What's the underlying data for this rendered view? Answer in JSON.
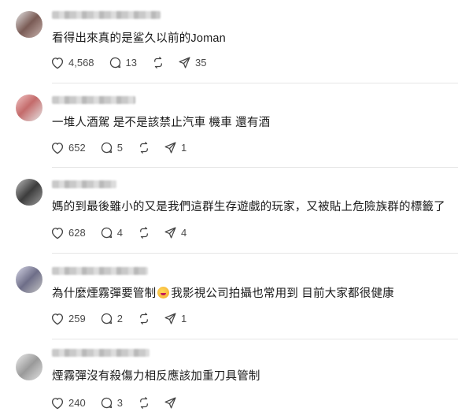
{
  "posts": [
    {
      "text": "看得出來真的是鲨久以前的Joman",
      "likes": "4,568",
      "comments": "13",
      "reposts": "",
      "shares": "35"
    },
    {
      "text": "一堆人酒駕 是不是該禁止汽車 機車 還有酒",
      "likes": "652",
      "comments": "5",
      "reposts": "",
      "shares": "1"
    },
    {
      "text": "媽的到最後雖小的又是我們這群生存遊戲的玩家，又被貼上危險族群的標籤了",
      "likes": "628",
      "comments": "4",
      "reposts": "",
      "shares": "4"
    },
    {
      "text_before_emoji": "為什麼煙霧彈要管制",
      "text_after_emoji": "我影視公司拍攝也常用到 目前大家都很健康",
      "emoji": "laughing-face-emoji",
      "likes": "259",
      "comments": "2",
      "reposts": "",
      "shares": "1"
    },
    {
      "text": "煙霧彈沒有殺傷力相反應該加重刀具管制",
      "likes": "240",
      "comments": "3",
      "reposts": "",
      "shares": ""
    }
  ],
  "icons": {
    "like": "heart-icon",
    "comment": "comment-bubble-icon",
    "repost": "repost-icon",
    "share": "send-icon"
  }
}
